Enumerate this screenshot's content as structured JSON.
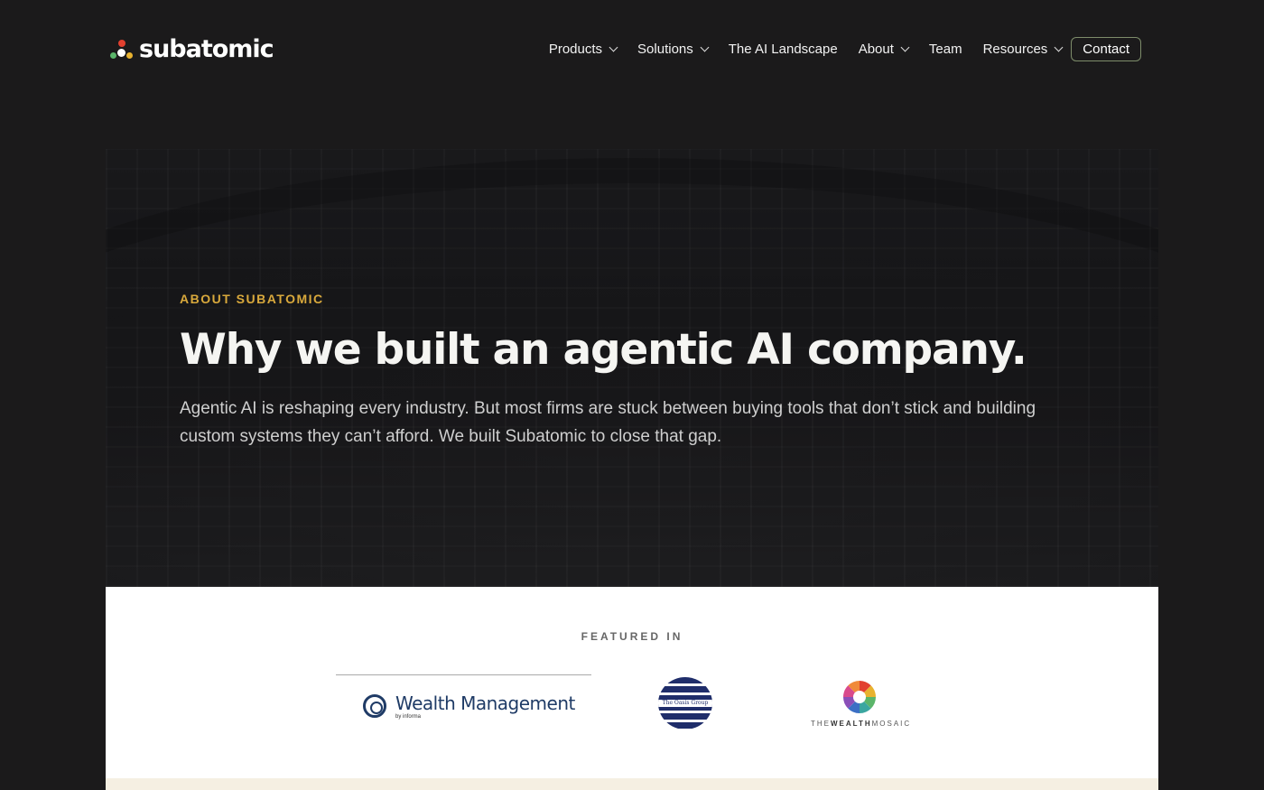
{
  "header": {
    "logo_text": "subatomic",
    "nav": [
      {
        "label": "Products",
        "dropdown": true
      },
      {
        "label": "Solutions",
        "dropdown": true
      },
      {
        "label": "The AI Landscape",
        "dropdown": false
      },
      {
        "label": "About",
        "dropdown": true
      },
      {
        "label": "Team",
        "dropdown": false
      },
      {
        "label": "Resources",
        "dropdown": true
      }
    ],
    "contact_label": "Contact"
  },
  "hero": {
    "eyebrow": "ABOUT SUBATOMIC",
    "title": "Why we built an agentic AI company.",
    "subtitle": "Agentic AI is reshaping every industry. But most firms are stuck between buying tools that don’t stick and building custom systems they can’t afford. We built Subatomic to close that gap."
  },
  "featured": {
    "label": "FEATURED IN",
    "logos": {
      "wealth_management": {
        "name": "Wealth Management",
        "sub": "by informa"
      },
      "oasis": {
        "name": "The Oasis Group"
      },
      "wealth_mosaic": {
        "prefix": "THE",
        "bold": "WEALTH",
        "suffix": "MOSAIC"
      }
    }
  },
  "colors": {
    "background": "#1b1a1b",
    "eyebrow_gold": "#d9a93c",
    "contact_border": "#7d8c6a",
    "featured_bg": "#ffffff"
  }
}
